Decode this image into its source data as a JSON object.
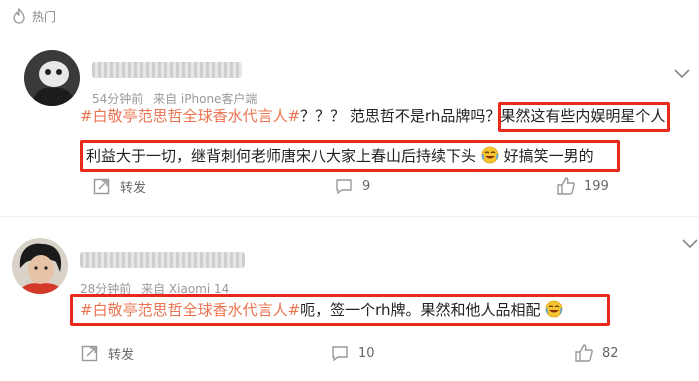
{
  "section": {
    "label": "热门",
    "icon": "flame-icon"
  },
  "comments": [
    {
      "time": "54分钟前",
      "source": "来自 iPhone客户端",
      "line1_tag": "#白敬亭范思哲全球香水代言人#",
      "line1_text": "？？？ 范思哲不是rh品牌吗？",
      "line1_highlight": "果然这有些内娱明星个人",
      "line2_text": "利益大于一切，继背刺何老师唐宋八大家上春山后持续下头",
      "line2_after": "好搞笑一男的",
      "emoji": "crying-laughing-emoji",
      "repost_label": "转发",
      "comment_count": "9",
      "like_count": "199"
    },
    {
      "time": "28分钟前",
      "source": "来自 Xiaomi 14",
      "line1_tag": "#白敬亭范思哲全球香水代言人#",
      "line1_text": "呃，签一个rh牌。果然和他人品相配",
      "emoji": "crying-laughing-emoji",
      "repost_label": "转发",
      "comment_count": "10",
      "like_count": "82"
    }
  ],
  "colors": {
    "tag": "#eb7350",
    "highlight_border": "#e8291c"
  }
}
